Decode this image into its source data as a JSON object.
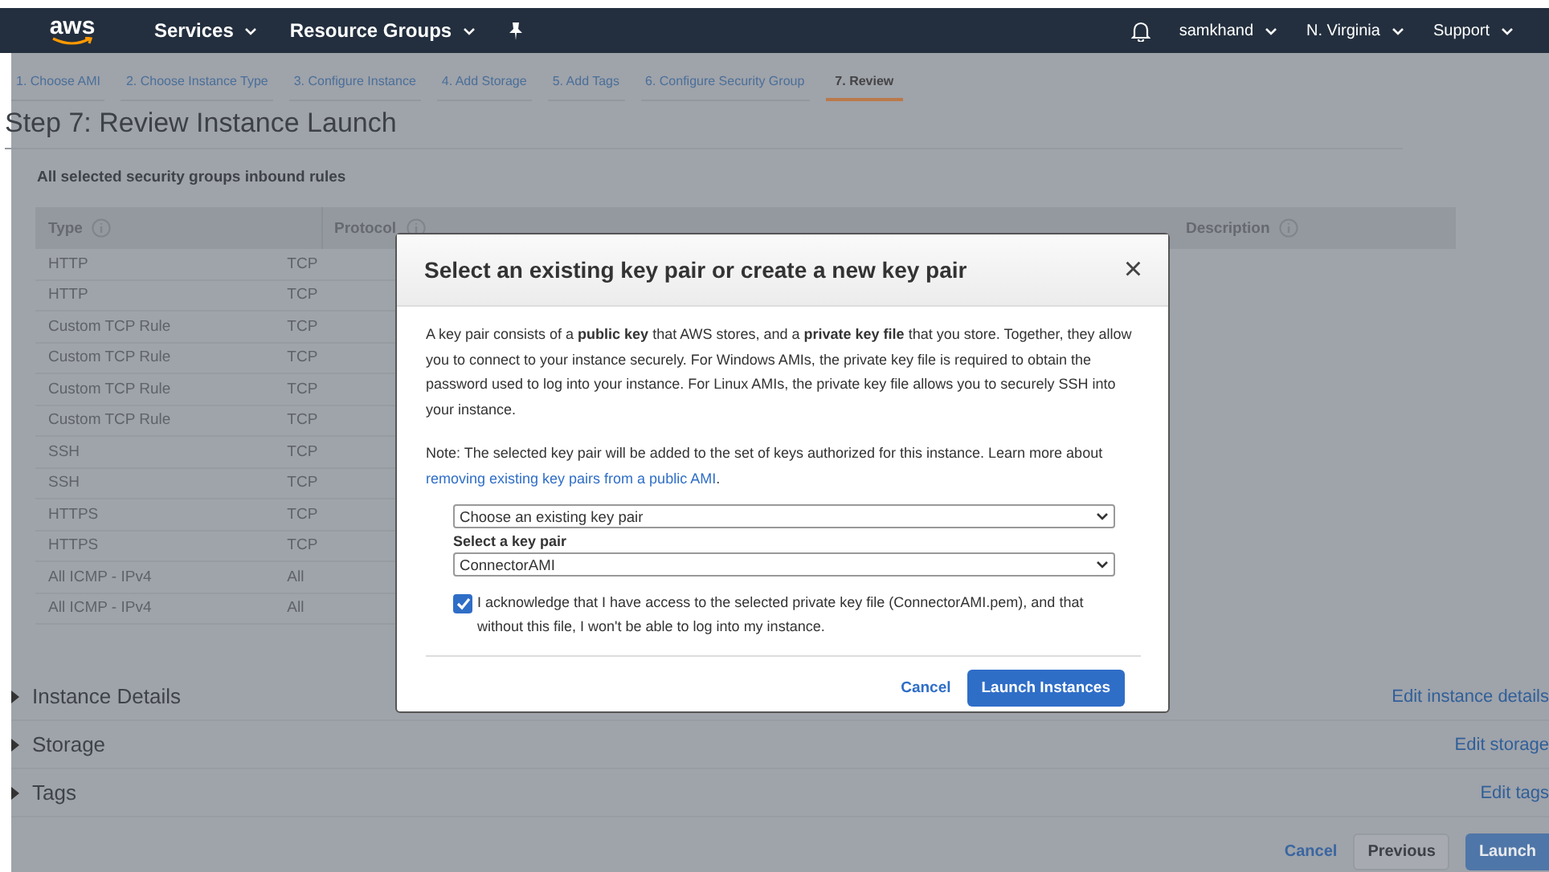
{
  "nav": {
    "logo": "aws",
    "menus": [
      {
        "label": "Services"
      },
      {
        "label": "Resource Groups"
      }
    ],
    "right": [
      {
        "label": "samkhand"
      },
      {
        "label": "N. Virginia"
      },
      {
        "label": "Support"
      }
    ]
  },
  "steps": [
    {
      "label": "1. Choose AMI",
      "selected": false
    },
    {
      "label": "2. Choose Instance Type",
      "selected": false
    },
    {
      "label": "3. Configure Instance",
      "selected": false
    },
    {
      "label": "4. Add Storage",
      "selected": false
    },
    {
      "label": "5. Add Tags",
      "selected": false
    },
    {
      "label": "6. Configure Security Group",
      "selected": false
    },
    {
      "label": "7. Review",
      "selected": true
    }
  ],
  "page_title": "Step 7: Review Instance Launch",
  "rules": {
    "title": "All selected security groups inbound rules",
    "columns": [
      "Type",
      "Protocol",
      "Description"
    ],
    "rows": [
      [
        "HTTP",
        "TCP"
      ],
      [
        "HTTP",
        "TCP"
      ],
      [
        "Custom TCP Rule",
        "TCP"
      ],
      [
        "Custom TCP Rule",
        "TCP"
      ],
      [
        "Custom TCP Rule",
        "TCP"
      ],
      [
        "Custom TCP Rule",
        "TCP"
      ],
      [
        "SSH",
        "TCP"
      ],
      [
        "SSH",
        "TCP"
      ],
      [
        "HTTPS",
        "TCP"
      ],
      [
        "HTTPS",
        "TCP"
      ],
      [
        "All ICMP - IPv4",
        "All"
      ],
      [
        "All ICMP - IPv4",
        "All"
      ]
    ]
  },
  "sections": [
    {
      "title": "Instance Details",
      "edit": "Edit instance details"
    },
    {
      "title": "Storage",
      "edit": "Edit storage"
    },
    {
      "title": "Tags",
      "edit": "Edit tags"
    }
  ],
  "footer_buttons": {
    "cancel": "Cancel",
    "previous": "Previous",
    "launch": "Launch"
  },
  "modal": {
    "title": "Select an existing key pair or create a new key pair",
    "close": "×",
    "intro": "A key pair consists of a **public key** that AWS stores, and a **private key file** that you store. Together, they allow you to connect to your instance securely. For Windows AMIs, the private key file is required to obtain the password used to log into your instance. For Linux AMIs, the private key file allows you to securely SSH into your instance.",
    "note": "Note: The selected key pair will be added to the set of keys authorized for this instance. Learn more about",
    "note_link": "removing existing key pairs from a public AMI",
    "note_end": ".",
    "mode_select": "Choose an existing key pair",
    "key_label": "Select a key pair",
    "key_select": "ConnectorAMI",
    "acknowledge": {
      "checked": true,
      "text": "I acknowledge that I have access to the selected private key file (ConnectorAMI.pem), and that without this file, I won't be able to log into my instance."
    },
    "cancel": "Cancel",
    "launch": "Launch Instances"
  }
}
